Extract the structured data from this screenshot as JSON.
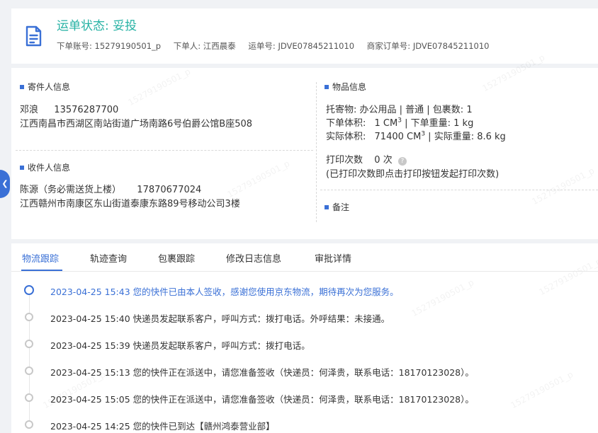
{
  "header": {
    "status_label": "运单状态:",
    "status_value": "妥投",
    "meta": [
      {
        "label": "下单账号:",
        "value": "15279190501_p"
      },
      {
        "label": "下单人:",
        "value": "江西晨泰"
      },
      {
        "label": "运单号:",
        "value": "JDVE07845211010"
      },
      {
        "label": "商家订单号:",
        "value": "JDVE07845211010"
      }
    ]
  },
  "sender": {
    "title": "寄件人信息",
    "name": "邓浪",
    "phone": "13576287700",
    "address": "江西南昌市西湖区南站街道广场南路6号伯爵公馆B座508"
  },
  "receiver": {
    "title": "收件人信息",
    "name": "陈源（务必需送货上楼）",
    "phone": "17870677024",
    "address": "江西赣州市南康区东山街道泰康东路89号移动公司3楼"
  },
  "goods": {
    "title": "物品信息",
    "line1": "托寄物:  办公用品 | 普通 | 包裹数:  1",
    "order_volume_label": "下单体积:",
    "order_volume_value": "1 CM",
    "order_weight": "下单重量:  1 kg",
    "actual_volume_label": "实际体积:",
    "actual_volume_value": "71400 CM",
    "actual_weight": "实际重量:  8.6 kg",
    "superscript": "3",
    "print_count_label": "打印次数",
    "print_count_value": "0 次",
    "print_note": "(已打印次数即点击打印按钮发起打印次数)"
  },
  "remark": {
    "title": "备注"
  },
  "tabs": [
    "物流跟踪",
    "轨迹查询",
    "包裹跟踪",
    "修改日志信息",
    "审批详情"
  ],
  "active_tab": "物流跟踪",
  "timeline": [
    {
      "time": "2023-04-25 15:43",
      "text": "您的快件已由本人签收，感谢您使用京东物流，期待再次为您服务。"
    },
    {
      "time": "2023-04-25 15:40",
      "text": "快递员发起联系客户，呼叫方式：拨打电话。外呼结果：未接通。"
    },
    {
      "time": "2023-04-25 15:39",
      "text": "快递员发起联系客户，呼叫方式：拨打电话。"
    },
    {
      "time": "2023-04-25 15:13",
      "text": "您的快件正在派送中，请您准备签收（快递员：何泽贵，联系电话：18170123028）。"
    },
    {
      "time": "2023-04-25 15:05",
      "text": "您的快件正在派送中，请您准备签收（快递员：何泽贵，联系电话：18170123028）。"
    },
    {
      "time": "2023-04-25 14:25",
      "text": "您的快件已到达【赣州鸿泰营业部】"
    }
  ],
  "watermark_text": "15279190501_p",
  "colors": {
    "accent": "#3a70d6",
    "status": "#27b2a4",
    "background": "#f0f2f5"
  },
  "icons": {
    "header": "document-icon",
    "side": "chevron-left-icon",
    "help": "question-icon"
  }
}
